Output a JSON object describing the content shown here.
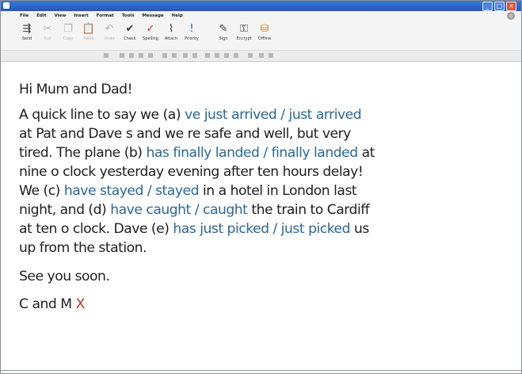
{
  "window": {
    "controls": {
      "minimize": "_",
      "maximize": "□",
      "close": "×"
    }
  },
  "menu": [
    "File",
    "Edit",
    "View",
    "Insert",
    "Format",
    "Tools",
    "Message",
    "Help"
  ],
  "toolbar": [
    {
      "label": "Send",
      "icon": "send-icon",
      "glyph": "⇶",
      "state": "enabled"
    },
    {
      "label": "Cut",
      "icon": "cut-icon",
      "glyph": "✂",
      "state": "disabled"
    },
    {
      "label": "Copy",
      "icon": "copy-icon",
      "glyph": "❐",
      "state": "disabled"
    },
    {
      "label": "Paste",
      "icon": "paste-icon",
      "glyph": "📋",
      "state": "disabled"
    },
    {
      "label": "Undo",
      "icon": "undo-icon",
      "glyph": "↶",
      "state": "disabled"
    },
    {
      "label": "Check",
      "icon": "check-names-icon",
      "glyph": "✔",
      "state": "enabled"
    },
    {
      "label": "Spelling",
      "icon": "spelling-icon",
      "glyph": "✓",
      "state": "enabled"
    },
    {
      "label": "Attach",
      "icon": "attach-icon",
      "glyph": "⌇",
      "state": "enabled"
    },
    {
      "label": "Priority",
      "icon": "priority-icon",
      "glyph": "!",
      "state": "enabled"
    },
    {
      "label": "Sign",
      "icon": "sign-icon",
      "glyph": "✎",
      "state": "enabled"
    },
    {
      "label": "Encrypt",
      "icon": "encrypt-icon",
      "glyph": "⚿",
      "state": "enabled"
    },
    {
      "label": "Offline",
      "icon": "offline-icon",
      "glyph": "⛁",
      "state": "enabled"
    }
  ],
  "email": {
    "greeting": "Hi Mum and Dad!",
    "line1_text": "A quick line to say we (a)",
    "a_answer": "ve just arrived / just arrived",
    "line2_text": "at Pat and Dave s and we re safe and well, but very",
    "line3_pre": "tired. The plane (b)",
    "b_answer": "has finally landed / finally landed",
    "line3_post": "at",
    "line4_text": "nine o clock yesterday evening after ten hours  delay!",
    "line5_pre": "We (c)",
    "c_answer": "have stayed / stayed",
    "line5_post": "in a hotel in London last",
    "line6_pre": "night, and (d)",
    "d_answer": "have caught / caught",
    "line6_post": "the train to Cardiff",
    "line7_pre": "at ten o clock. Dave (e)",
    "e_answer": "has just picked / just picked",
    "line7_post": "us",
    "line8_text": "up from the station.",
    "closing": "See you soon.",
    "signature": "C and M",
    "kiss": "X"
  },
  "colors": {
    "answer": "#2a6897",
    "kiss": "#c32f2b",
    "body_text": "#1e1e1e",
    "titlebar": "#2457b8"
  }
}
